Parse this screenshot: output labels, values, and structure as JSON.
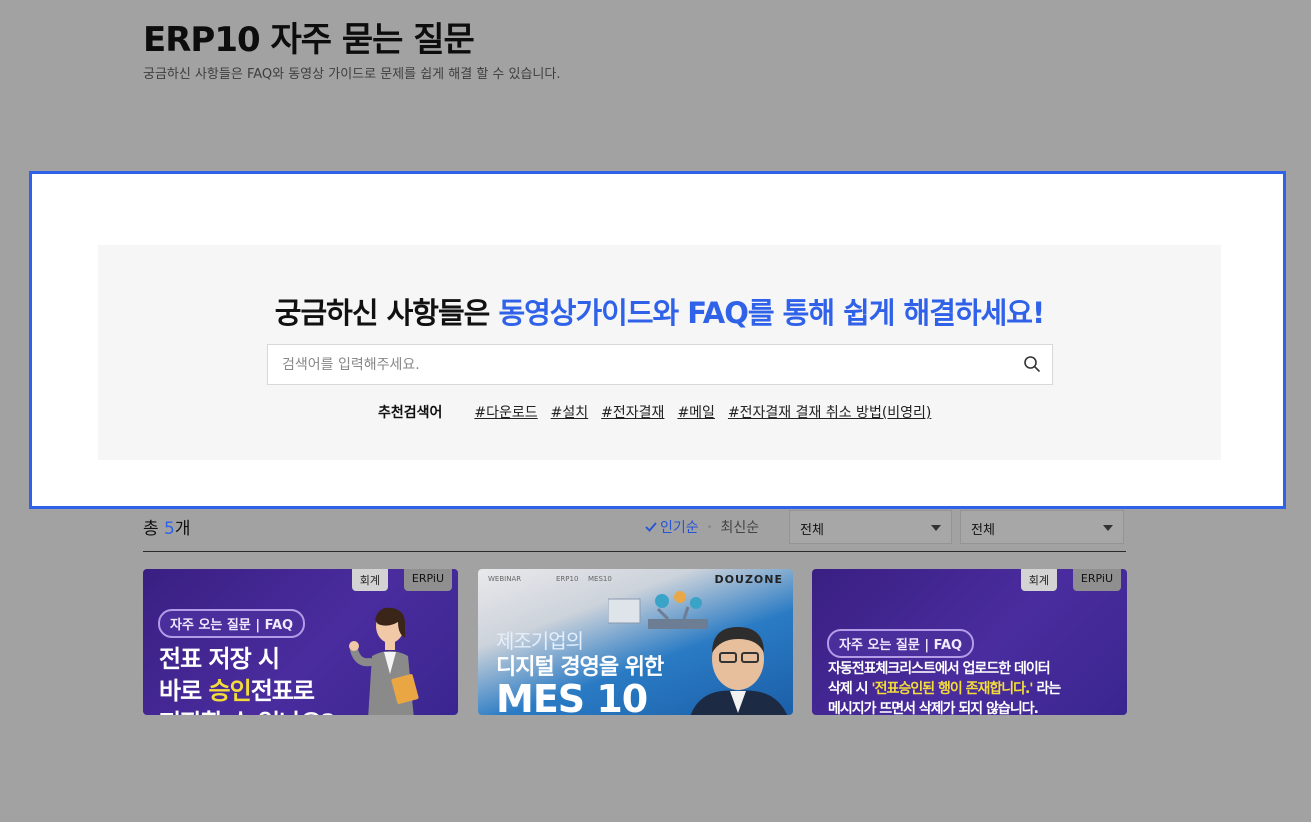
{
  "page": {
    "title": "ERP10 자주 묻는 질문",
    "subtitle": "궁금하신 사항들은 FAQ와 동영상 가이드로 문제를 쉽게 해결 할 수 있습니다."
  },
  "search": {
    "headline_part1": "궁금하신 사항들은 ",
    "headline_accent": "동영상가이드와 FAQ를 통해 쉽게 해결하세요!",
    "placeholder": "검색어를 입력해주세요.",
    "value": "",
    "button_icon": "search-icon",
    "tags_label": "추천검색어",
    "tags": [
      "#다운로드",
      "#설치",
      "#전자결재",
      "#메일",
      "#전자결재 결재 취소 방법(비영리)"
    ]
  },
  "list": {
    "count_prefix": "총 ",
    "count_value": "5",
    "count_suffix": "개",
    "sort_active": "인기순",
    "sort_other": "최신순",
    "filter1": "전체",
    "filter2": "전체"
  },
  "cards": [
    {
      "badges": [
        "회계",
        "ERPiU"
      ],
      "pill": "자주 오는 질문 | FAQ",
      "line1": "전표 저장 시",
      "line2_a": "바로 ",
      "line2_b": "승인",
      "line2_c": "전표로",
      "line3": "저장할 수 없나요?"
    },
    {
      "brand": "DOUZONE",
      "top_tags": [
        "WEBINAR",
        "ERP10",
        "MES10"
      ],
      "line1": "제조기업의",
      "line2": "디지털 경영을 위한",
      "line3": "MES 10"
    },
    {
      "badges": [
        "회계",
        "ERPiU"
      ],
      "pill": "자주 오는 질문 | FAQ",
      "line1": "자동전표체크리스트에서 업로드한 데이터",
      "line2_a": "삭제 시 ",
      "line2_b": "'전표승인된 행이 존재합니다.'",
      "line2_c": " 라는",
      "line3": "메시지가 뜨면서 삭제가 되지 않습니다."
    }
  ],
  "colors": {
    "accent": "#2f62e8",
    "frame": "#2f62e8",
    "overlay": "#a2a2a2"
  }
}
